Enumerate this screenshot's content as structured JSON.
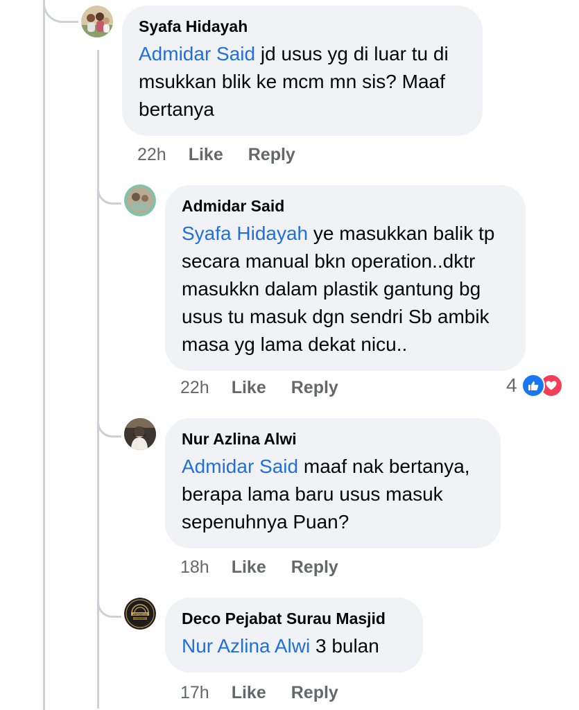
{
  "comments": [
    {
      "author": "Syafa Hidayah",
      "mention": "Admidar Said",
      "text": " jd usus yg di luar tu di msukkan blik ke mcm mn sis? Maaf bertanya",
      "time": "22h",
      "like_label": "Like",
      "reply_label": "Reply"
    },
    {
      "author": "Admidar Said",
      "mention": "Syafa Hidayah",
      "text": " ye masukkan balik tp secara manual bkn operation..dktr masukkn dalam plastik gantung bg usus tu masuk dgn sendri Sb ambik masa yg lama dekat nicu..",
      "time": "22h",
      "like_label": "Like",
      "reply_label": "Reply",
      "reaction_count": "4",
      "reactions": [
        "like-icon",
        "love-icon"
      ]
    },
    {
      "author": "Nur Azlina Alwi",
      "mention": "Admidar Said",
      "text": " maaf nak bertanya, berapa lama baru usus masuk sepenuhnya Puan?",
      "time": "18h",
      "like_label": "Like",
      "reply_label": "Reply"
    },
    {
      "author": "Deco Pejabat Surau Masjid",
      "mention": "Nur Azlina Alwi",
      "text": " 3 bulan",
      "time": "17h",
      "like_label": "Like",
      "reply_label": "Reply",
      "avatar_text": [
        "ARTDECO",
        "CONCEPT"
      ]
    }
  ],
  "colors": {
    "bubble": "#f0f2f5",
    "mention": "#216fdb",
    "meta": "#65676b",
    "like_reaction": "#1877f2",
    "love_reaction": "#f33e58"
  }
}
